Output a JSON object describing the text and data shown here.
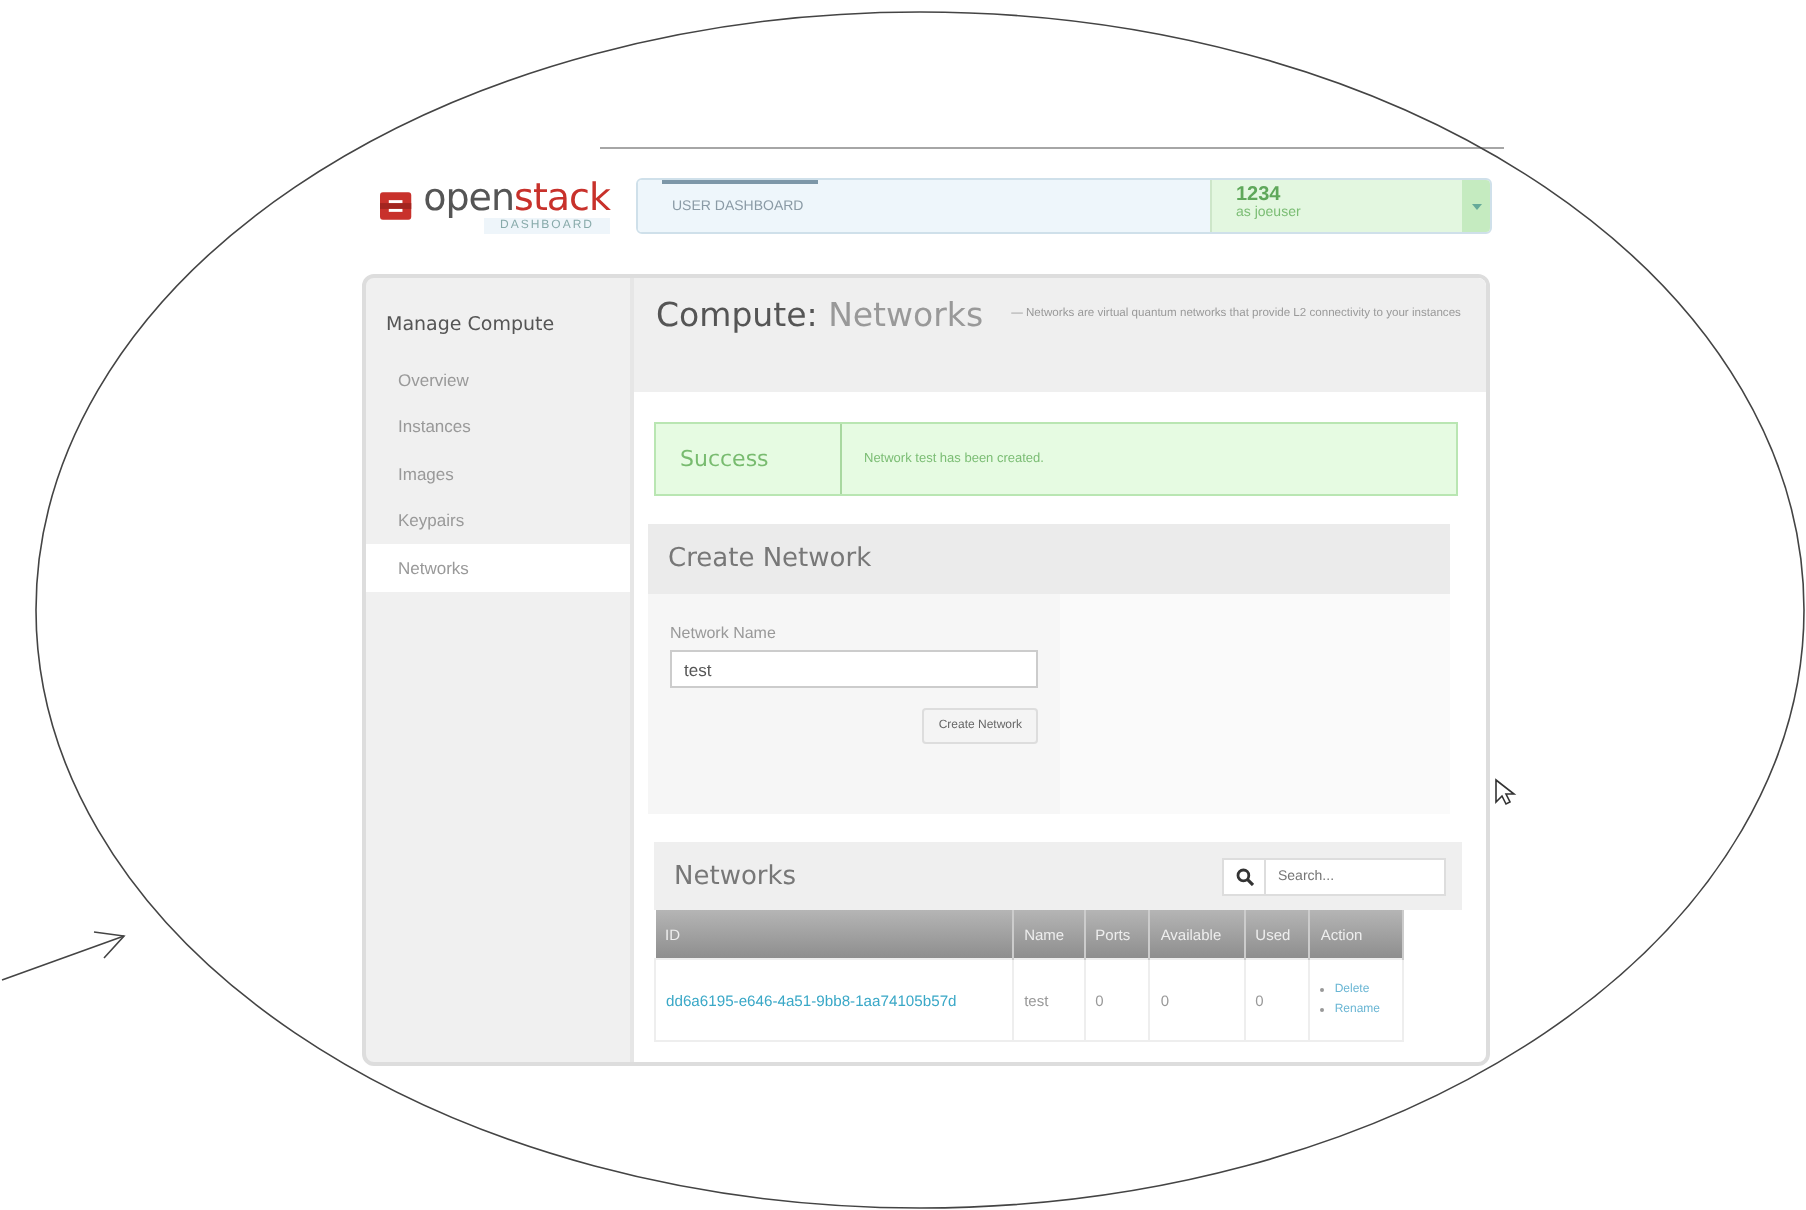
{
  "logo": {
    "name_parts": [
      "open",
      "stack"
    ],
    "subtitle": "DASHBOARD"
  },
  "topbar": {
    "label": "USER DASHBOARD",
    "tenant": "1234",
    "user": "as joeuser"
  },
  "sidebar": {
    "heading": "Manage Compute",
    "items": [
      {
        "label": "Overview",
        "selected": false
      },
      {
        "label": "Instances",
        "selected": false
      },
      {
        "label": "Images",
        "selected": false
      },
      {
        "label": "Keypairs",
        "selected": false
      },
      {
        "label": "Networks",
        "selected": true
      }
    ]
  },
  "page": {
    "section": "Compute:",
    "title": "Networks",
    "description": "— Networks are virtual quantum networks that provide L2 connectivity to your instances"
  },
  "alert": {
    "title": "Success",
    "message": "Network test has been created."
  },
  "form": {
    "title": "Create Network",
    "field_label": "Network Name",
    "field_value": "test",
    "submit": "Create Network"
  },
  "table": {
    "title": "Networks",
    "search_placeholder": "Search...",
    "columns": [
      "ID",
      "Name",
      "Ports",
      "Available",
      "Used",
      "Action"
    ],
    "rows": [
      {
        "cells": [
          "dd6a6195-e646-4a51-9bb8-1aa74105b57d",
          "test",
          "0",
          "0",
          "0"
        ],
        "actions": [
          "Delete",
          "Rename"
        ]
      }
    ]
  }
}
